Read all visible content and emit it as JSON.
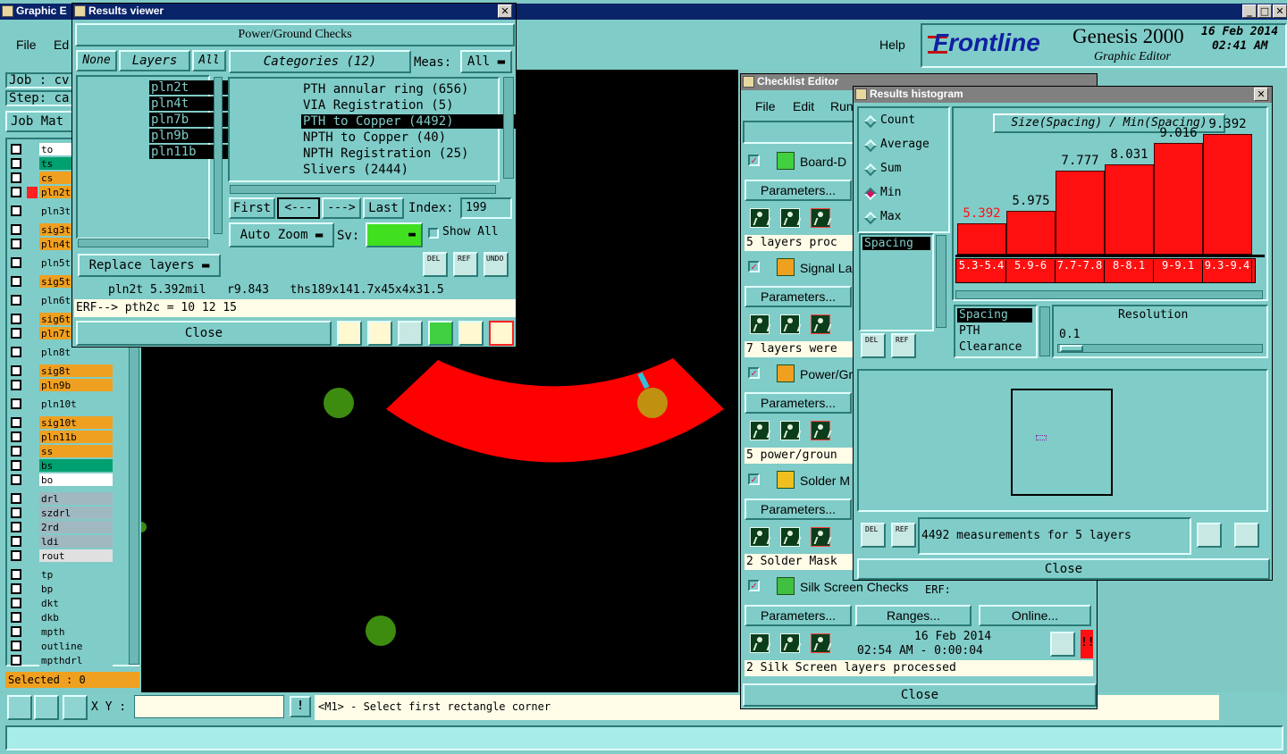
{
  "main_window": {
    "title": "Graphic E",
    "menu": [
      "File",
      "Ed"
    ],
    "help": "Help",
    "job_label": "Job : cv",
    "step_label": "Step: ca",
    "job_matrix": "Job Mat",
    "selected": "Selected : 0",
    "xy_label": "X Y :",
    "prompt": "<M1> - Select first rectangle corner",
    "logo": "Frontline",
    "product": "Genesis 2000",
    "subtitle": "Graphic Editor",
    "date": "16 Feb 2014",
    "time": "02:41 AM"
  },
  "layers": [
    {
      "name": "to",
      "color": "#ffffff"
    },
    {
      "name": "ts",
      "color": "#00a070"
    },
    {
      "name": "cs",
      "color": "#f0a020"
    },
    {
      "name": "pln2t",
      "color": "#f0a020",
      "mark": "#ff2020"
    },
    {
      "name": "pln3t",
      "color": "#80ccc8"
    },
    {
      "name": "sig3t",
      "color": "#f0a020"
    },
    {
      "name": "pln4t",
      "color": "#f0a020"
    },
    {
      "name": "pln5t",
      "color": "#80ccc8"
    },
    {
      "name": "sig5t",
      "color": "#f0a020"
    },
    {
      "name": "pln6t",
      "color": "#80ccc8"
    },
    {
      "name": "sig6t",
      "color": "#f0a020"
    },
    {
      "name": "pln7t",
      "color": "#f0a020"
    },
    {
      "name": "pln8t",
      "color": "#80ccc8"
    },
    {
      "name": "sig8t",
      "color": "#f0a020"
    },
    {
      "name": "pln9b",
      "color": "#f0a020"
    },
    {
      "name": "pln10t",
      "color": "#80ccc8"
    },
    {
      "name": "sig10t",
      "color": "#f0a020"
    },
    {
      "name": "pln11b",
      "color": "#f0a020"
    },
    {
      "name": "ss",
      "color": "#f0a020"
    },
    {
      "name": "bs",
      "color": "#00a070"
    },
    {
      "name": "bo",
      "color": "#ffffff"
    },
    {
      "name": "drl",
      "color": "#a0b8c0"
    },
    {
      "name": "szdrl",
      "color": "#a0b8c0"
    },
    {
      "name": "2rd",
      "color": "#a0b8c0"
    },
    {
      "name": "ldi",
      "color": "#a0b8c0"
    },
    {
      "name": "rout",
      "color": "#e0e0e0"
    },
    {
      "name": "tp",
      "color": "#80ccc8"
    },
    {
      "name": "bp",
      "color": "#80ccc8"
    },
    {
      "name": "dkt",
      "color": "#80ccc8"
    },
    {
      "name": "dkb",
      "color": "#80ccc8"
    },
    {
      "name": "mpth",
      "color": "#80ccc8"
    },
    {
      "name": "outline",
      "color": "#80ccc8"
    },
    {
      "name": "mpthdrl",
      "color": "#80ccc8"
    }
  ],
  "results_viewer": {
    "title": "Results viewer",
    "header": "Power/Ground Checks",
    "none": "None",
    "layers_label": "Layers",
    "all": "All",
    "layer_list": [
      "pln2t",
      "pln4t",
      "pln7b",
      "pln9b",
      "pln11b"
    ],
    "categories_label": "Categories (12)",
    "meas_label": "Meas:",
    "meas_value": "All",
    "categories": [
      "PTH annular ring (656)",
      "VIA Registration (5)",
      "PTH to Copper (4492)",
      "NPTH to Copper (40)",
      "NPTH Registration (25)",
      "Slivers (2444)"
    ],
    "first": "First",
    "prev": "<---",
    "next": "--->",
    "last": "Last",
    "index_label": "Index:",
    "index_value": "199",
    "auto_zoom": "Auto Zoom",
    "sv_label": "Sv:",
    "show_all": "Show All",
    "replace_layers": "Replace layers",
    "del": "DEL",
    "ref": "REF",
    "undo": "UNDO",
    "info": "pln2t 5.392mil   r9.843   ths189x141.7x45x4x31.5",
    "erf": "ERF--> pth2c = 10 12 15",
    "close": "Close"
  },
  "checklist_editor": {
    "title": "Checklist Editor",
    "menu": [
      "File",
      "Edit",
      "Run"
    ],
    "checks": [
      {
        "name": "Board-D",
        "status": "5 layers proc"
      },
      {
        "name": "Signal La",
        "status": "7 layers were"
      },
      {
        "name": "Power/Gr",
        "status": "5 power/groun"
      },
      {
        "name": "Solder M",
        "status": "2 Solder Mask"
      },
      {
        "name": "Silk Screen Checks",
        "status": "2 Silk Screen layers processed"
      }
    ],
    "parameters": "Parameters...",
    "ranges": "Ranges...",
    "online": "Online...",
    "erf": "ERF:",
    "run_date": "16 Feb 2014",
    "run_time": "02:54 AM - 0:00:04",
    "close": "Close"
  },
  "histogram": {
    "title": "Results histogram",
    "modes": [
      "Count",
      "Average",
      "Sum",
      "Min",
      "Max"
    ],
    "selected_mode": "Min",
    "chart_title": "Size(Spacing) / Min(Spacing)",
    "list1": [
      "Spacing"
    ],
    "list2": [
      "Spacing",
      "PTH",
      "Clearance"
    ],
    "resolution_label": "Resolution",
    "resolution_value": "0.1",
    "measurements": "4492 measurements for 5 layers",
    "close": "Close",
    "del": "DEL",
    "ref": "REF"
  },
  "chart_data": {
    "type": "bar",
    "title": "Size(Spacing) / Min(Spacing)",
    "categories": [
      "5.3-5.4",
      "5.9-6",
      "7.7-7.8",
      "8-8.1",
      "9-9.1",
      "9.3-9.4"
    ],
    "values": [
      5.392,
      5.975,
      7.777,
      8.031,
      9.016,
      9.392
    ],
    "labels": [
      "5.392",
      "5.975",
      "7.777",
      "8.031",
      "9.016",
      "9.392"
    ],
    "first_label_color": "#ff1010",
    "ylim": [
      4,
      10
    ]
  }
}
